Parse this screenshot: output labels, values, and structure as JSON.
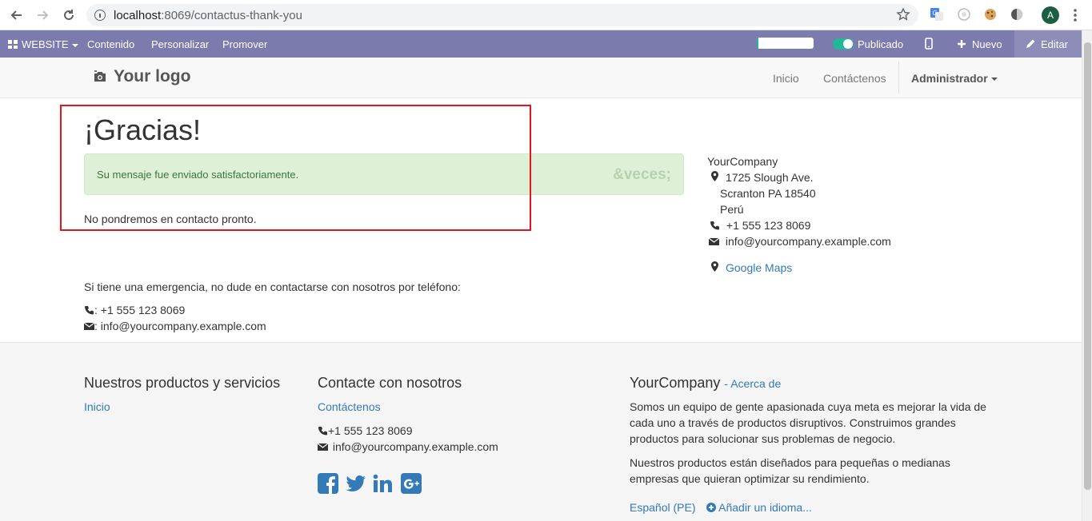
{
  "browser": {
    "url_host": "localhost",
    "url_rest": ":8069/contactus-thank-you",
    "avatar_letter": "A"
  },
  "odoo_bar": {
    "website_label": "WEBSITE",
    "menu": [
      "Contenido",
      "Personalizar",
      "Promover"
    ],
    "published_label": "Publicado",
    "new_label": "Nuevo",
    "edit_label": "Editar",
    "progress_fraction": 0.03,
    "accent_color": "#7c7bad"
  },
  "header": {
    "logo_text": "Your logo",
    "nav": [
      "Inicio",
      "Contáctenos"
    ],
    "user_menu": "Administrador"
  },
  "main": {
    "title": "¡Gracias!",
    "alert_message": "Su mensaje fue enviado satisfactoriamente.",
    "alert_close": "&veces;",
    "followup": "No pondremos en contacto pronto.",
    "emergency_text": "Si tiene una emergencia, no dude en contactarse con nosotros por teléfono:",
    "phone_line": ": +1 555 123 8069",
    "email_line": ": info@yourcompany.example.com"
  },
  "sidebar": {
    "company": "YourCompany",
    "address": [
      "1725 Slough Ave.",
      "Scranton PA 18540",
      "Perú"
    ],
    "phone": "+1 555 123 8069",
    "email": "info@yourcompany.example.com",
    "maps_link": "Google Maps"
  },
  "footer": {
    "products_heading": "Nuestros productos y servicios",
    "products_links": [
      "Inicio"
    ],
    "contact_heading": "Contacte con nosotros",
    "contact_link": "Contáctenos",
    "contact_phone": "+1 555 123 8069",
    "contact_email": "info@yourcompany.example.com",
    "about_company": "YourCompany",
    "about_link": "- Acerca de",
    "about_p1": [
      "Somos un equipo de gente apasionada cuya meta es mejorar la vida de",
      "cada uno a través de productos disruptivos. Construimos grandes",
      "productos para solucionar sus problemas de negocio."
    ],
    "about_p2": [
      "Nuestros productos están diseñados para pequeñas o medianas",
      "empresas que quieran optimizar su rendimiento."
    ],
    "language": "Español (PE)",
    "add_language": "Añadir un idioma..."
  }
}
